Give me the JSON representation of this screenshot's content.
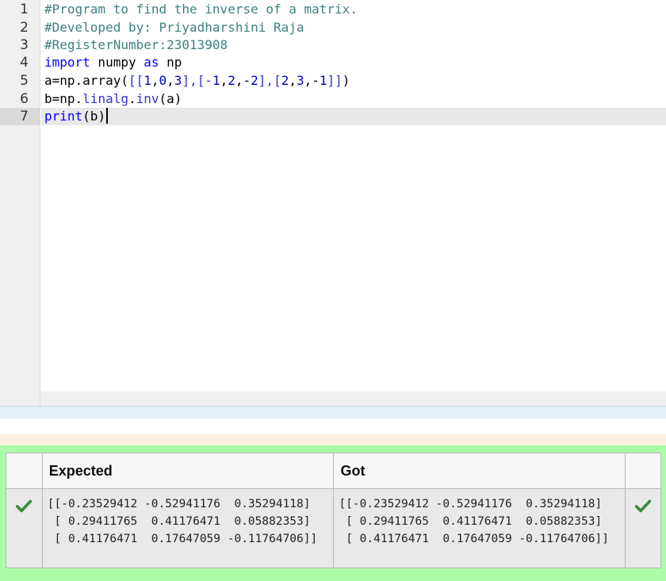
{
  "editor": {
    "line_numbers": [
      "1",
      "2",
      "3",
      "4",
      "5",
      "6",
      "7"
    ],
    "active_line": "7",
    "lines": {
      "l1": "#Program to find the inverse of a matrix.",
      "l2": "#Developed by: Priyadharshini Raja",
      "l3": "#RegisterNumber:23013908",
      "l4_kw1": "import",
      "l4_mod": " numpy ",
      "l4_kw2": "as",
      "l4_alias": " np",
      "l5_a": "a=np.array(",
      "l5_b": "[[",
      "l5_n1": "1",
      "l5_c1": ",",
      "l5_n2": "0",
      "l5_c2": ",",
      "l5_n3": "3",
      "l5_d": "],[-",
      "l5_n4": "1",
      "l5_c3": ",",
      "l5_n5": "2",
      "l5_c4": ",-",
      "l5_n6": "2",
      "l5_e": "],[",
      "l5_n7": "2",
      "l5_c5": ",",
      "l5_n8": "3",
      "l5_c6": ",-",
      "l5_n9": "1",
      "l5_f": "]]",
      "l5_g": ")",
      "l6_a": "b=np.",
      "l6_b": "linalg",
      "l6_c": ".",
      "l6_d": "inv",
      "l6_e": "(a)",
      "l7_fn": "print",
      "l7_rest": "(b)"
    }
  },
  "results": {
    "header_expected": "Expected",
    "header_got": "Got",
    "expected": [
      "[[-0.23529412 -0.52941176  0.35294118]",
      " [ 0.29411765  0.41176471  0.05882353]",
      " [ 0.41176471  0.17647059 -0.11764706]]"
    ],
    "got": [
      "[[-0.23529412 -0.52941176  0.35294118]",
      " [ 0.29411765  0.41176471  0.05882353]",
      " [ 0.41176471  0.17647059 -0.11764706]]"
    ],
    "status_icon": "check-icon",
    "colors": {
      "pass_background": "#abfca9",
      "check_color": "#3c8a3c"
    }
  }
}
